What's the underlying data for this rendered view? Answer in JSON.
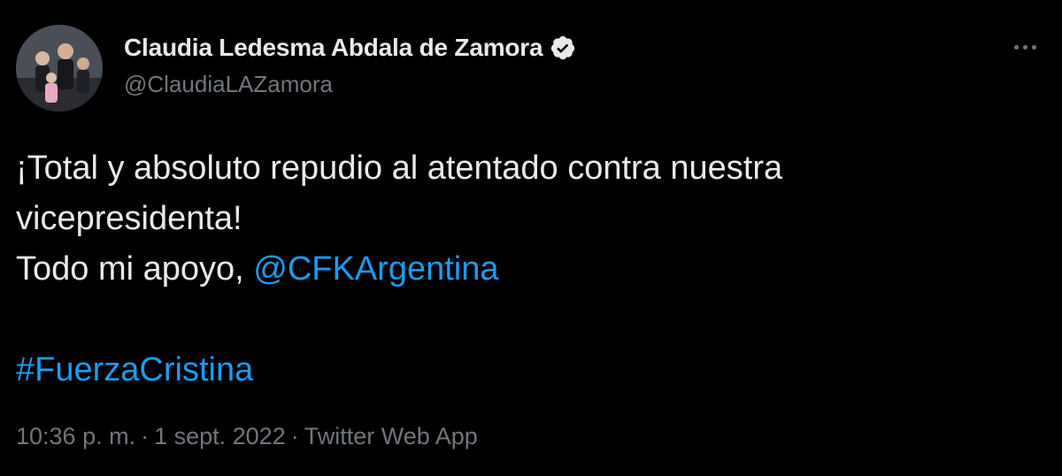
{
  "user": {
    "display_name": "Claudia Ledesma Abdala de Zamora",
    "handle": "@ClaudiaLAZamora",
    "verified": true
  },
  "tweet": {
    "line1": "¡Total y absoluto repudio al atentado contra nuestra",
    "line2": "vicepresidenta!",
    "line3_prefix": "Todo mi apoyo, ",
    "mention": "@CFKArgentina",
    "hashtag": "#FuerzaCristina"
  },
  "meta": {
    "time": "10:36 p. m.",
    "separator": "·",
    "date": "1 sept. 2022",
    "source": "Twitter Web App"
  },
  "icons": {
    "verified": "verified-badge-icon",
    "more": "more-options-icon"
  },
  "colors": {
    "background": "#000000",
    "text": "#e7e9ea",
    "secondary": "#71767b",
    "link": "#1d9bf0"
  }
}
